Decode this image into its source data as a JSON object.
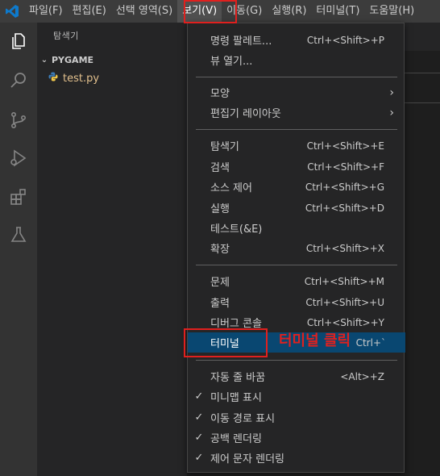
{
  "menubar": {
    "items": [
      {
        "label": "파일(F)"
      },
      {
        "label": "편집(E)"
      },
      {
        "label": "선택 영역(S)"
      },
      {
        "label": "보기(V)"
      },
      {
        "label": "이동(G)"
      },
      {
        "label": "실행(R)"
      },
      {
        "label": "터미널(T)"
      },
      {
        "label": "도움말(H)"
      }
    ]
  },
  "activitybar": {
    "icons": [
      "files-icon",
      "search-icon",
      "source-control-icon",
      "run-debug-icon",
      "extensions-icon",
      "testing-icon"
    ]
  },
  "sidebar": {
    "title": "탐색기",
    "folder": "PYGAME",
    "file": "test.py"
  },
  "view_menu": {
    "groups": [
      [
        {
          "label": "명령 팔레트...",
          "shortcut": "Ctrl+<Shift>+P"
        },
        {
          "label": "뷰 열기...",
          "shortcut": ""
        }
      ],
      [
        {
          "label": "모양",
          "submenu": true
        },
        {
          "label": "편집기 레이아웃",
          "submenu": true
        }
      ],
      [
        {
          "label": "탐색기",
          "shortcut": "Ctrl+<Shift>+E"
        },
        {
          "label": "검색",
          "shortcut": "Ctrl+<Shift>+F"
        },
        {
          "label": "소스 제어",
          "shortcut": "Ctrl+<Shift>+G"
        },
        {
          "label": "실행",
          "shortcut": "Ctrl+<Shift>+D"
        },
        {
          "label": "테스트(&E)",
          "shortcut": ""
        },
        {
          "label": "확장",
          "shortcut": "Ctrl+<Shift>+X"
        }
      ],
      [
        {
          "label": "문제",
          "shortcut": "Ctrl+<Shift>+M"
        },
        {
          "label": "출력",
          "shortcut": "Ctrl+<Shift>+U"
        },
        {
          "label": "디버그 콘솔",
          "shortcut": "Ctrl+<Shift>+Y"
        },
        {
          "label": "터미널",
          "shortcut": "Ctrl+`"
        }
      ],
      [
        {
          "label": "자동 줄 바꿈",
          "shortcut": "<Alt>+Z",
          "checked": false
        },
        {
          "label": "미니맵 표시",
          "checked": true
        },
        {
          "label": "이동 경로 표시",
          "checked": true
        },
        {
          "label": "공백 렌더링",
          "checked": true
        },
        {
          "label": "제어 문자 렌더링",
          "checked": true
        }
      ]
    ],
    "selected": "터미널"
  },
  "annotation": "터미널 클릭",
  "colors": {
    "highlight": "#094771",
    "annotation_red": "#e0201e",
    "menubar_bg": "#3c3c3c"
  }
}
